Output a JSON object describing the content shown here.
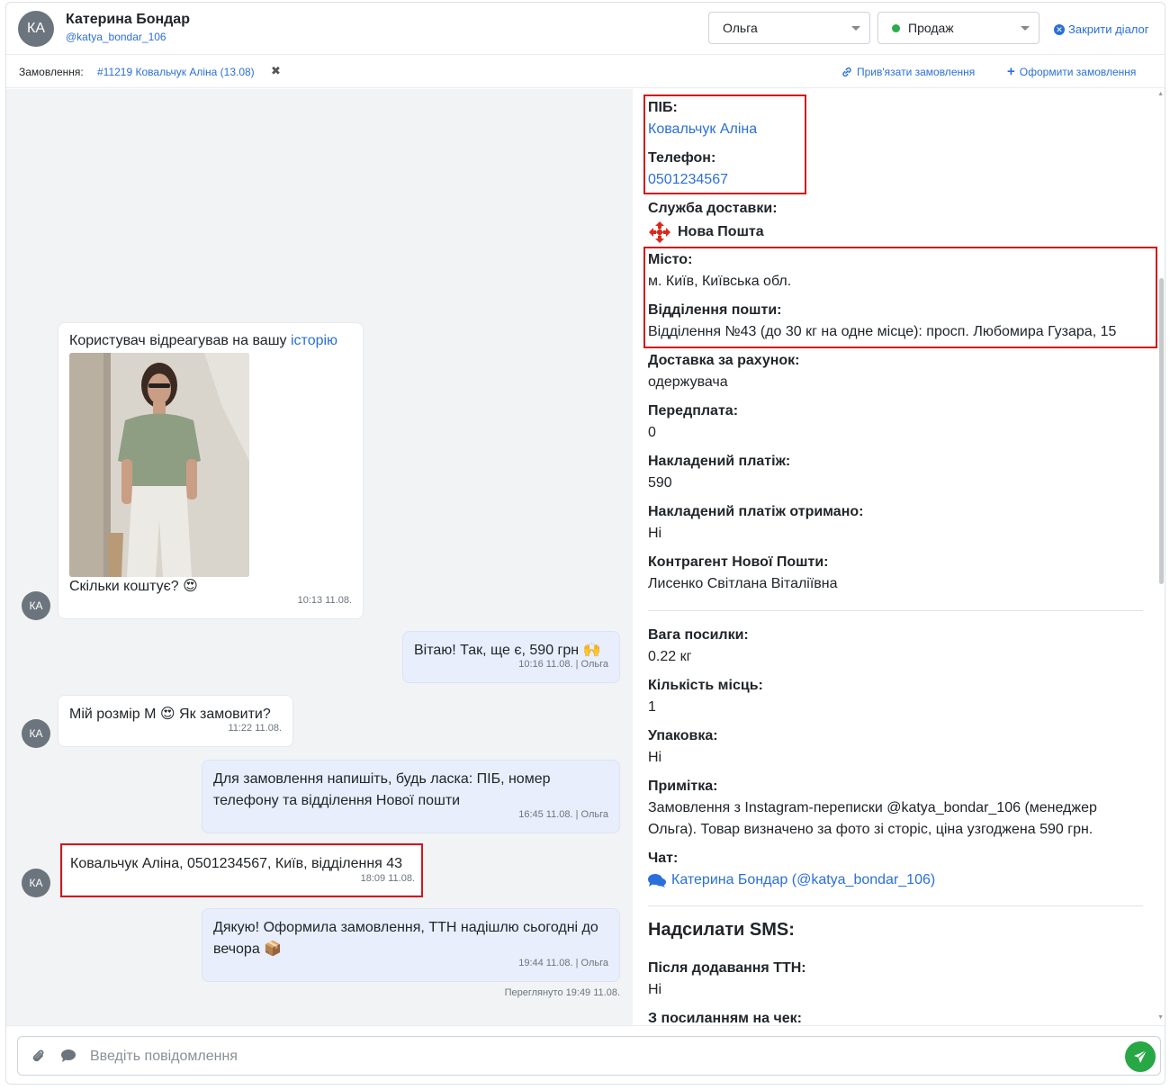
{
  "header": {
    "avatar_initials": "КА",
    "user_name": "Катерина Бондар",
    "user_handle": "@katya_bondar_106",
    "manager_select": "Ольга",
    "status_select": "Продаж",
    "close_dialog": "Закрити діалог"
  },
  "order_bar": {
    "label": "Замовлення:",
    "order_link": "#11219 Ковальчук Аліна (13.08)",
    "remove": "✖",
    "link_order": "Прив'язати замовлення",
    "create_order": "Оформити замовлення"
  },
  "messages": [
    {
      "direction": "in",
      "avatar": "КА",
      "text": "Користувач відреагував на вашу ",
      "link": "історію",
      "caption": "Скільки коштує? 😍",
      "meta": "10:13 11.08."
    },
    {
      "direction": "out",
      "text": "Вітаю! Так, ще є, 590 грн 🙌",
      "meta": "10:16 11.08. | Ольга"
    },
    {
      "direction": "in",
      "avatar": "КА",
      "text": "Мій розмір М 😍 Як замовити?",
      "meta": "11:22 11.08."
    },
    {
      "direction": "out",
      "text": "Для замовлення напишіть, будь ласка: ПІБ, номер телефону та відділення Нової пошти",
      "meta": "16:45 11.08. | Ольга"
    },
    {
      "direction": "in",
      "avatar": "КА",
      "text": "Ковальчук Аліна, 0501234567, Київ, відділення 43",
      "meta": "18:09 11.08."
    },
    {
      "direction": "out",
      "text": "Дякую! Оформила замовлення, ТТН надішлю сьогодні до вечора 📦",
      "meta": "19:44 11.08. | Ольга"
    }
  ],
  "viewed": "Переглянуто 19:49 11.08.",
  "panel": {
    "name_label": "ПІБ:",
    "name_value": "Ковальчук Аліна",
    "phone_label": "Телефон:",
    "phone_value": "0501234567",
    "delivery_label": "Служба доставки:",
    "delivery_value": "Нова Пошта",
    "city_label": "Місто:",
    "city_value": "м. Київ, Київська обл.",
    "branch_label": "Відділення пошти:",
    "branch_value": "Відділення №43 (до 30 кг на одне місце): просп. Любомира Гузара, 15",
    "payer_label": "Доставка за рахунок:",
    "payer_value": "одержувача",
    "prepay_label": "Передплата:",
    "prepay_value": "0",
    "cod_label": "Накладений платіж:",
    "cod_value": "590",
    "cod_received_label": "Накладений платіж отримано:",
    "cod_received_value": "Ні",
    "counterparty_label": "Контрагент Нової Пошти:",
    "counterparty_value": "Лисенко Світлана Віталіївна",
    "weight_label": "Вага посилки:",
    "weight_value": "0.22 кг",
    "places_label": "Кількість місць:",
    "places_value": "1",
    "packing_label": "Упаковка:",
    "packing_value": "Ні",
    "note_label": "Примітка:",
    "note_line1": "Замовлення з Instagram-переписки @katya_bondar_106 (менеджер",
    "note_line2": "Ольга). Товар визначено за фото зі сторіс, ціна узгоджена 590 грн.",
    "chat_label": "Чат:",
    "chat_value": "Катерина Бондар (@katya_bondar_106)",
    "sms_title": "Надсилати SMS:",
    "after_ttn_label": "Після додавання ТТН:",
    "after_ttn_value": "Ні",
    "receipt_label": "З посиланням на чек:"
  },
  "composer": {
    "placeholder": "Введіть повідомлення"
  },
  "colors": {
    "accent": "#2a6fdb",
    "highlight": "#d0161c",
    "send": "#28a745",
    "nova_poshta": "#da291c"
  }
}
